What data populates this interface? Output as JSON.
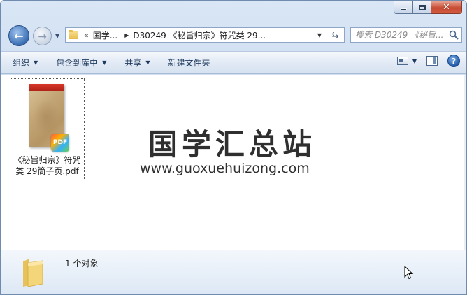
{
  "window": {
    "caption": {
      "minimize_icon": "minimize-icon",
      "maximize_icon": "maximize-icon",
      "close_icon": "close-icon"
    }
  },
  "nav": {
    "back_icon": "back-arrow-icon",
    "forward_icon": "forward-arrow-icon",
    "breadcrumb": {
      "overflow": "«",
      "segments": [
        "国学...",
        "D30249 《秘旨归宗》符咒类 29..."
      ]
    },
    "search_placeholder": "搜索 D30249 《秘旨...",
    "refresh_icon": "refresh-icon"
  },
  "commands": {
    "organize": "组织",
    "include_in_library": "包含到库中",
    "share": "共享",
    "new_folder": "新建文件夹"
  },
  "files": [
    {
      "name": "《秘旨归宗》符咒类 29筒子页.pdf",
      "type_badge": "PDF",
      "icon": "pdf-file-icon"
    }
  ],
  "watermark": {
    "title": "国学汇总站",
    "url": "www.guoxuehuizong.com"
  },
  "details": {
    "item_count": "1 个对象"
  },
  "colors": {
    "close_button": "#c74a32",
    "command_text": "#1e395b",
    "pdf_top_band": "#d8382a"
  }
}
